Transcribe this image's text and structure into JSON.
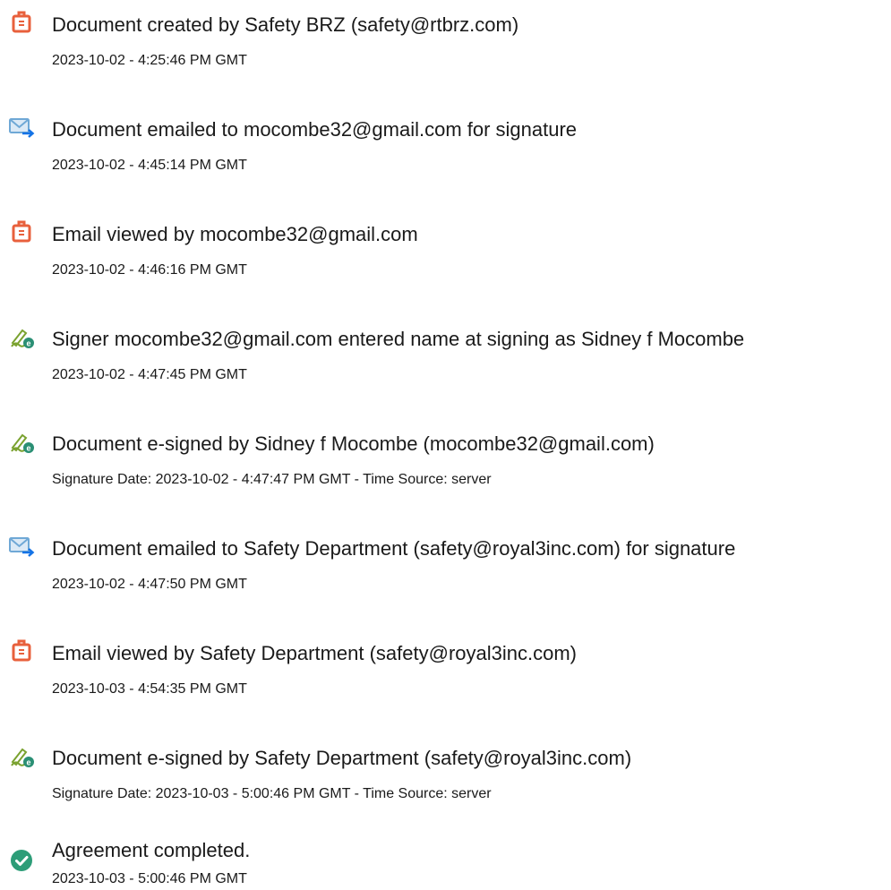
{
  "events": [
    {
      "icon": "document-icon",
      "title": "Document created by Safety BRZ (safety@rtbrz.com)",
      "date": "2023-10-02 - 4:25:46 PM GMT"
    },
    {
      "icon": "email-sent-icon",
      "title": "Document emailed to mocombe32@gmail.com for signature",
      "date": "2023-10-02 - 4:45:14 PM GMT"
    },
    {
      "icon": "document-icon",
      "title": "Email viewed by mocombe32@gmail.com",
      "date": "2023-10-02 - 4:46:16 PM GMT"
    },
    {
      "icon": "e-sign-icon",
      "title": "Signer mocombe32@gmail.com entered name at signing as Sidney f Mocombe",
      "date": "2023-10-02 - 4:47:45 PM GMT"
    },
    {
      "icon": "e-sign-icon",
      "title": "Document e-signed by Sidney f Mocombe (mocombe32@gmail.com)",
      "date": "Signature Date: 2023-10-02 - 4:47:47 PM GMT - Time Source: server"
    },
    {
      "icon": "email-sent-icon",
      "title": "Document emailed to Safety Department (safety@royal3inc.com) for signature",
      "date": "2023-10-02 - 4:47:50 PM GMT"
    },
    {
      "icon": "document-icon",
      "title": "Email viewed by Safety Department (safety@royal3inc.com)",
      "date": "2023-10-03 - 4:54:35 PM GMT"
    },
    {
      "icon": "e-sign-icon",
      "title": "Document e-signed by Safety Department (safety@royal3inc.com)",
      "date": "Signature Date: 2023-10-03 - 5:00:46 PM GMT - Time Source: server"
    },
    {
      "icon": "check-circle-icon",
      "title": "Agreement completed.",
      "date": "2023-10-03 - 5:00:46 PM GMT"
    }
  ],
  "colors": {
    "document_icon": "#e8603c",
    "email_icon": "#6fa8d6",
    "email_arrow": "#1473e6",
    "sign_icon": "#7aa22f",
    "sign_badge": "#2a8f74",
    "check_icon": "#2d9d78"
  }
}
